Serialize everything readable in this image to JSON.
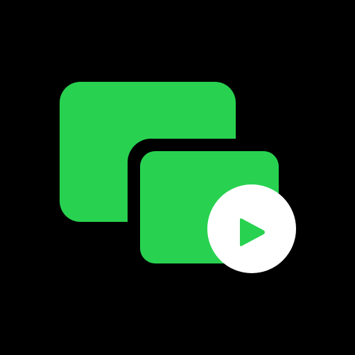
{
  "icon": {
    "name": "picture-in-picture-play-icon",
    "background_color": "#000000",
    "window_color": "#28D250",
    "badge_color": "#FFFFFF",
    "play_color": "#28D250"
  }
}
